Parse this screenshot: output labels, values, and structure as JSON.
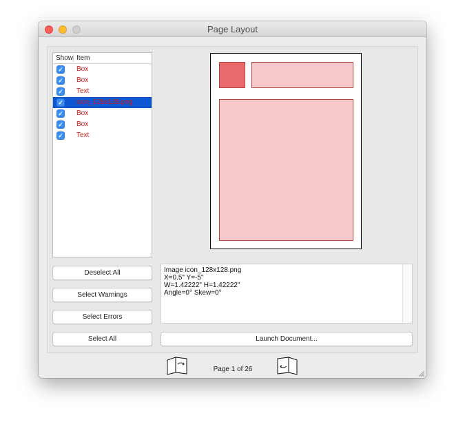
{
  "window": {
    "title": "Page Layout"
  },
  "list": {
    "columns": {
      "show": "Show",
      "item": "Item"
    },
    "rows": [
      {
        "label": "Box",
        "checked": true,
        "selected": false
      },
      {
        "label": "Box",
        "checked": true,
        "selected": false
      },
      {
        "label": "Text",
        "checked": true,
        "selected": false
      },
      {
        "label": "icon_128x128.png",
        "checked": true,
        "selected": true
      },
      {
        "label": "Box",
        "checked": true,
        "selected": false
      },
      {
        "label": "Box",
        "checked": true,
        "selected": false
      },
      {
        "label": "Text",
        "checked": true,
        "selected": false
      }
    ]
  },
  "buttons": {
    "deselect_all": "Deselect All",
    "select_warnings": "Select Warnings",
    "select_errors": "Select Errors",
    "select_all": "Select All",
    "launch_document": "Launch Document..."
  },
  "info": {
    "line1": "Image icon_128x128.png",
    "line2": "X=0.5\" Y=-5\"",
    "line3": "W=1.42222\" H=1.42222\"",
    "line4": "Angle=0° Skew=0°"
  },
  "pager": {
    "text": "Page 1 of 26"
  },
  "colors": {
    "item_text": "#d01818",
    "selection": "#0b58d2",
    "shape_selected": "#e86a6a",
    "shape_fill": "#f6caca"
  }
}
